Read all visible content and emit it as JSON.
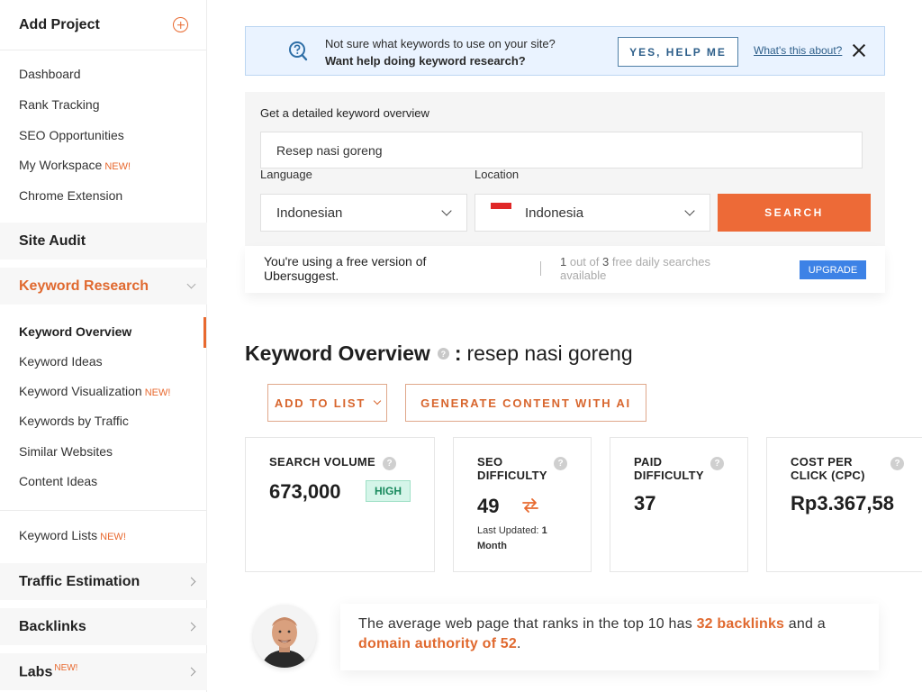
{
  "sidebar": {
    "add_project": "Add Project",
    "items": [
      {
        "label": "Dashboard",
        "tag": ""
      },
      {
        "label": "Rank Tracking",
        "tag": ""
      },
      {
        "label": "SEO Opportunities",
        "tag": ""
      },
      {
        "label": "My Workspace",
        "tag": "NEW!"
      },
      {
        "label": "Chrome Extension",
        "tag": ""
      }
    ],
    "site_audit": "Site Audit",
    "keyword_research": "Keyword Research",
    "kr_items": [
      {
        "label": "Keyword Overview",
        "tag": ""
      },
      {
        "label": "Keyword Ideas",
        "tag": ""
      },
      {
        "label": "Keyword Visualization",
        "tag": "NEW!"
      },
      {
        "label": "Keywords by Traffic",
        "tag": ""
      },
      {
        "label": "Similar Websites",
        "tag": ""
      },
      {
        "label": "Content Ideas",
        "tag": ""
      }
    ],
    "keyword_lists": {
      "label": "Keyword Lists",
      "tag": "NEW!"
    },
    "traffic_estimation": "Traffic Estimation",
    "backlinks": "Backlinks",
    "labs": {
      "label": "Labs",
      "tag": "NEW!"
    }
  },
  "banner": {
    "line1": "Not sure what keywords to use on your site?",
    "line2": "Want help doing keyword research?",
    "yes_button": "YES, HELP ME",
    "link": "What's this about?"
  },
  "search": {
    "title": "Get a detailed keyword overview",
    "keyword_value": "Resep nasi goreng",
    "language_label": "Language",
    "language_value": "Indonesian",
    "location_label": "Location",
    "location_value": "Indonesia",
    "search_button": "SEARCH"
  },
  "free_bar": {
    "message": "You're using a free version of Ubersuggest.",
    "used": "1",
    "out_of": " out of ",
    "total": "3",
    "rest": " free daily searches available",
    "upgrade": "UPGRADE"
  },
  "overview": {
    "heading": "Keyword Overview",
    "colon": ":",
    "keyword": "resep nasi goreng",
    "add_to_list": "ADD TO LIST",
    "generate": "GENERATE CONTENT WITH AI"
  },
  "metrics": {
    "search_volume": {
      "label": "SEARCH VOLUME",
      "value": "673,000",
      "badge": "HIGH"
    },
    "seo_difficulty": {
      "label_1": "SEO",
      "label_2": "DIFFICULTY",
      "value": "49",
      "updated_label": "Last Updated:",
      "updated_value_1": "1",
      "updated_value_2": "Month"
    },
    "paid_difficulty": {
      "label_1": "PAID",
      "label_2": "DIFFICULTY",
      "value": "37"
    },
    "cpc": {
      "label_1": "COST PER",
      "label_2": "CLICK (CPC)",
      "value": "Rp3.367,58"
    }
  },
  "tip": {
    "part1": "The average web page that ranks in the top 10 has ",
    "backlinks": "32 backlinks",
    "part2": " and a ",
    "authority": "domain authority of 52",
    "part3": "."
  },
  "colors": {
    "accent": "#e8692f",
    "search_button": "#ed6a37",
    "upgrade": "#3d82e6",
    "banner_bg": "#eaf3ff"
  }
}
